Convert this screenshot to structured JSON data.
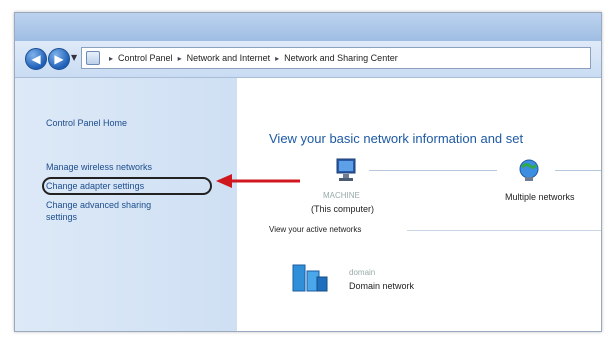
{
  "address_bar": {
    "crumbs": [
      "Control Panel",
      "Network and Internet",
      "Network and Sharing Center"
    ]
  },
  "sidebar": {
    "home": "Control Panel Home",
    "links": [
      "Manage wireless networks",
      "Change adapter settings",
      "Change advanced sharing",
      "settings"
    ]
  },
  "main": {
    "heading": "View your basic network information and set",
    "computer_name": "MACHINE",
    "computer_label": "(This computer)",
    "network_label": "Multiple networks",
    "active_section": "View your active networks",
    "domain_name": "domain",
    "domain_type": "Domain network"
  },
  "icons": {
    "back": "back-arrow-icon",
    "forward": "forward-arrow-icon",
    "address": "control-panel-icon",
    "computer": "computer-icon",
    "network": "network-icon",
    "domain": "domain-network-icon"
  },
  "colors": {
    "link": "#1d4d8c",
    "heading": "#1e5aa5",
    "arrow": "#d0171d",
    "sidebar": "#d6e5f6"
  }
}
